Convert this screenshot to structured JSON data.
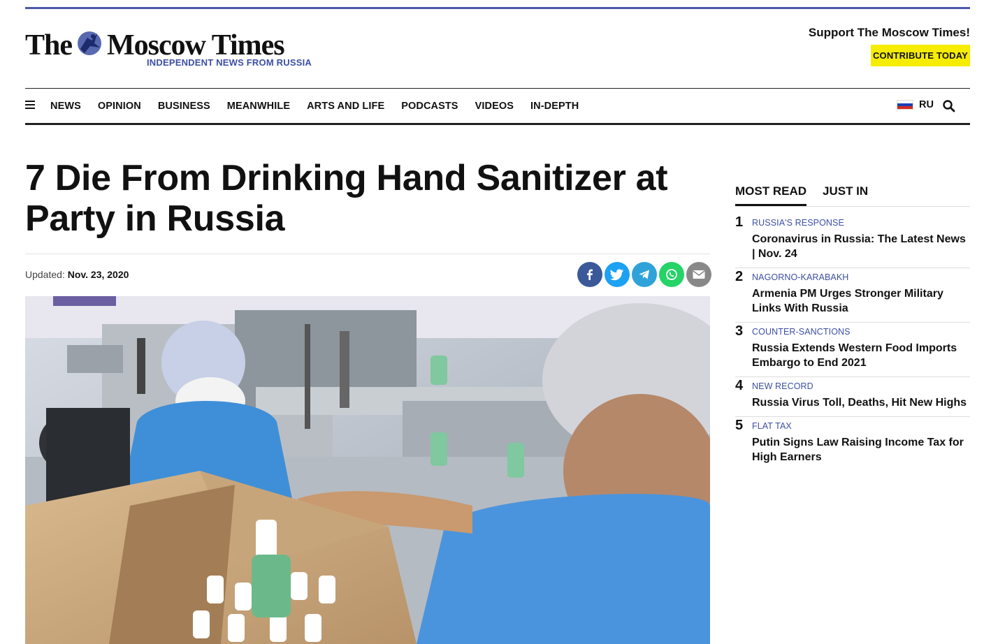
{
  "site": {
    "logo_the": "The",
    "logo_name": "Moscow Times",
    "tagline": "INDEPENDENT NEWS FROM RUSSIA",
    "brand_color": "#3c4fa2"
  },
  "support": {
    "text": "Support The Moscow Times!",
    "button_label": "CONTRIBUTE TODAY",
    "button_color": "#f5ec00"
  },
  "nav": {
    "menu_icon": "hamburger-menu-icon",
    "items": [
      "NEWS",
      "OPINION",
      "BUSINESS",
      "MEANWHILE",
      "ARTS AND LIFE",
      "PODCASTS",
      "VIDEOS",
      "IN-DEPTH"
    ],
    "lang_label": "RU",
    "flag_icon": "russia-flag-icon",
    "search_icon": "search-icon"
  },
  "article": {
    "headline": "7 Die From Drinking Hand Sanitizer at Party in Russia",
    "updated_label": "Updated:",
    "updated_date": "Nov. 23, 2020",
    "share": [
      {
        "icon": "facebook-icon",
        "color": "#3b5998"
      },
      {
        "icon": "twitter-icon",
        "color": "#1da1f2"
      },
      {
        "icon": "telegram-icon",
        "color": "#2fa3d9"
      },
      {
        "icon": "whatsapp-icon",
        "color": "#25d366"
      },
      {
        "icon": "email-icon",
        "color": "#888888"
      }
    ]
  },
  "sidebar": {
    "tabs": [
      "MOST READ",
      "JUST IN"
    ],
    "most_read": [
      {
        "num": "1",
        "category": "RUSSIA'S RESPONSE",
        "title": "Coronavirus in Russia: The Latest News | Nov. 24"
      },
      {
        "num": "2",
        "category": "NAGORNO-KARABAKH",
        "title": "Armenia PM Urges Stronger Military Links With Russia"
      },
      {
        "num": "3",
        "category": "COUNTER-SANCTIONS",
        "title": "Russia Extends Western Food Imports Embargo to End 2021"
      },
      {
        "num": "4",
        "category": "NEW RECORD",
        "title": "Russia Virus Toll, Deaths, Hit New Highs"
      },
      {
        "num": "5",
        "category": "FLAT TAX",
        "title": "Putin Signs Law Raising Income Tax for High Earners"
      }
    ]
  }
}
